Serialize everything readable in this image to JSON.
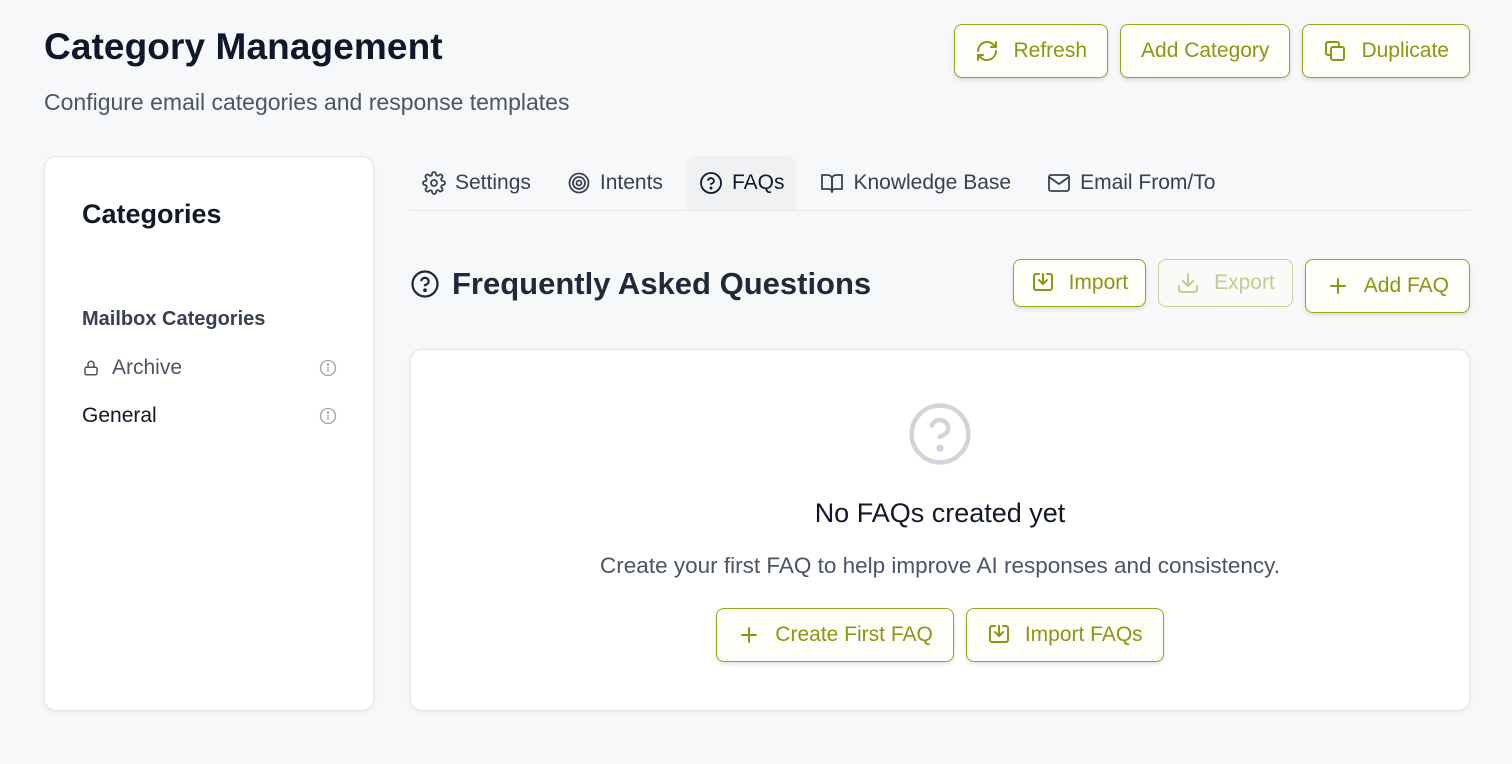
{
  "header": {
    "title": "Category Management",
    "subtitle": "Configure email categories and response templates",
    "refresh_label": "Refresh",
    "add_category_label": "Add Category",
    "duplicate_label": "Duplicate"
  },
  "sidebar": {
    "title": "Categories",
    "section_label": "Mailbox Categories",
    "items": [
      {
        "label": "Archive",
        "icon": "lock-icon",
        "locked": true
      },
      {
        "label": "General",
        "locked": false
      }
    ]
  },
  "tabs": [
    {
      "label": "Settings",
      "icon": "gear-icon"
    },
    {
      "label": "Intents",
      "icon": "target-icon"
    },
    {
      "label": "FAQs",
      "icon": "question-circle-icon",
      "active": true
    },
    {
      "label": "Knowledge Base",
      "icon": "book-icon"
    },
    {
      "label": "Email From/To",
      "icon": "mail-icon"
    }
  ],
  "faq_section": {
    "title": "Frequently Asked Questions",
    "import_label": "Import",
    "export_label": "Export",
    "add_label": "Add FAQ"
  },
  "empty_state": {
    "title": "No FAQs created yet",
    "description": "Create your first FAQ to help improve AI responses and consistency.",
    "create_label": "Create First FAQ",
    "import_label": "Import FAQs"
  },
  "colors": {
    "accent": "#8c9614",
    "accent_border": "#9aa51c",
    "background": "#f7f8fa"
  }
}
